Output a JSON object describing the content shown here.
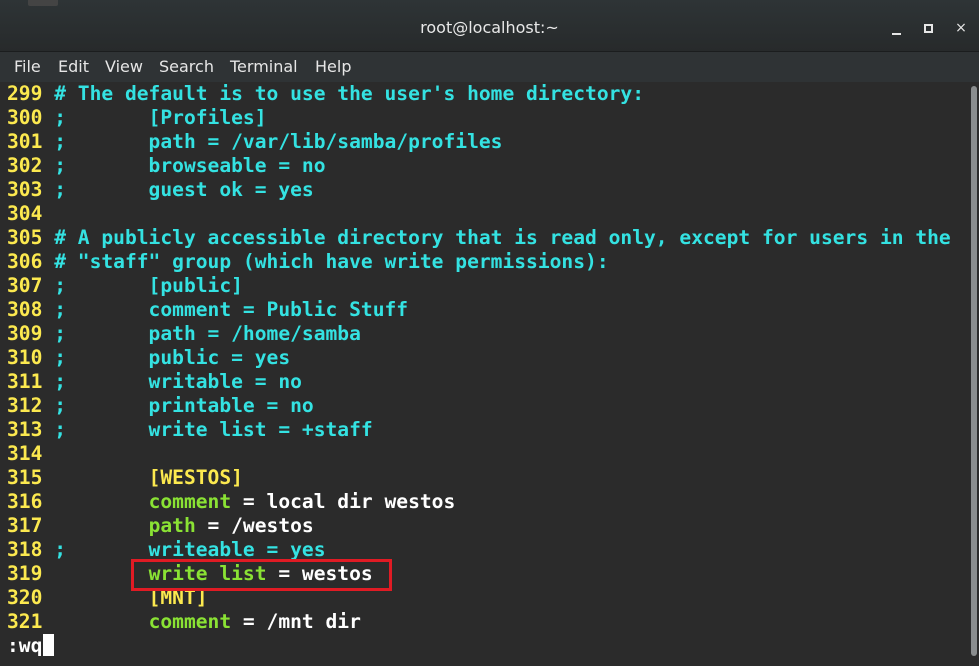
{
  "window": {
    "title": "root@localhost:~",
    "controls": {
      "minimize_icon": "minimize-icon",
      "maximize_icon": "maximize-icon",
      "close_label": "×"
    }
  },
  "menubar": {
    "items": [
      "File",
      "Edit",
      "View",
      "Search",
      "Terminal",
      "Help"
    ]
  },
  "editor": {
    "lines": [
      {
        "num": "299",
        "segments": [
          {
            "t": "# The default is to use the user's home directory:",
            "c": "cy"
          }
        ]
      },
      {
        "num": "300",
        "segments": [
          {
            "t": ";       [Profiles]",
            "c": "cy"
          }
        ]
      },
      {
        "num": "301",
        "segments": [
          {
            "t": ";       path = /var/lib/samba/profiles",
            "c": "cy"
          }
        ]
      },
      {
        "num": "302",
        "segments": [
          {
            "t": ";       browseable = no",
            "c": "cy"
          }
        ]
      },
      {
        "num": "303",
        "segments": [
          {
            "t": ";       guest ok = yes",
            "c": "cy"
          }
        ]
      },
      {
        "num": "304",
        "segments": []
      },
      {
        "num": "305",
        "segments": [
          {
            "t": "# A publicly accessible directory that is read only, except for users in the",
            "c": "cy"
          }
        ]
      },
      {
        "num": "306",
        "segments": [
          {
            "t": "# \"staff\" group (which have write permissions):",
            "c": "cy"
          }
        ]
      },
      {
        "num": "307",
        "segments": [
          {
            "t": ";       [public]",
            "c": "cy"
          }
        ]
      },
      {
        "num": "308",
        "segments": [
          {
            "t": ";       comment = Public Stuff",
            "c": "cy"
          }
        ]
      },
      {
        "num": "309",
        "segments": [
          {
            "t": ";       path = /home/samba",
            "c": "cy"
          }
        ]
      },
      {
        "num": "310",
        "segments": [
          {
            "t": ";       public = yes",
            "c": "cy"
          }
        ]
      },
      {
        "num": "311",
        "segments": [
          {
            "t": ";       writable = no",
            "c": "cy"
          }
        ]
      },
      {
        "num": "312",
        "segments": [
          {
            "t": ";       printable = no",
            "c": "cy"
          }
        ]
      },
      {
        "num": "313",
        "segments": [
          {
            "t": ";       write list = +staff",
            "c": "cy"
          }
        ]
      },
      {
        "num": "314",
        "segments": []
      },
      {
        "num": "315",
        "segments": [
          {
            "t": "        ",
            "c": "wh"
          },
          {
            "t": "[WESTOS]",
            "c": "yl"
          }
        ]
      },
      {
        "num": "316",
        "segments": [
          {
            "t": "        ",
            "c": "wh"
          },
          {
            "t": "comment",
            "c": "gr"
          },
          {
            "t": " = local dir westos",
            "c": "wh"
          }
        ]
      },
      {
        "num": "317",
        "segments": [
          {
            "t": "        ",
            "c": "wh"
          },
          {
            "t": "path",
            "c": "gr"
          },
          {
            "t": " = /westos",
            "c": "wh"
          }
        ]
      },
      {
        "num": "318",
        "segments": [
          {
            "t": ";       writeable = yes",
            "c": "cy"
          }
        ]
      },
      {
        "num": "319",
        "segments": [
          {
            "t": "        ",
            "c": "wh"
          },
          {
            "t": "write list",
            "c": "gr"
          },
          {
            "t": " = westos",
            "c": "wh"
          }
        ]
      },
      {
        "num": "320",
        "segments": [
          {
            "t": "        ",
            "c": "wh"
          },
          {
            "t": "[MNT]",
            "c": "yl"
          }
        ]
      },
      {
        "num": "321",
        "segments": [
          {
            "t": "        ",
            "c": "wh"
          },
          {
            "t": "comment",
            "c": "gr"
          },
          {
            "t": " = /mnt dir",
            "c": "wh"
          }
        ]
      }
    ],
    "command_line": ":wq",
    "highlighted_line": "319"
  },
  "colors": {
    "comment": "#34e2e2",
    "line_number": "#fce94f",
    "section": "#fce94f",
    "key": "#8ae234",
    "value": "#ffffff",
    "highlight_border": "#e01b24",
    "background": "#2b2b2b"
  }
}
